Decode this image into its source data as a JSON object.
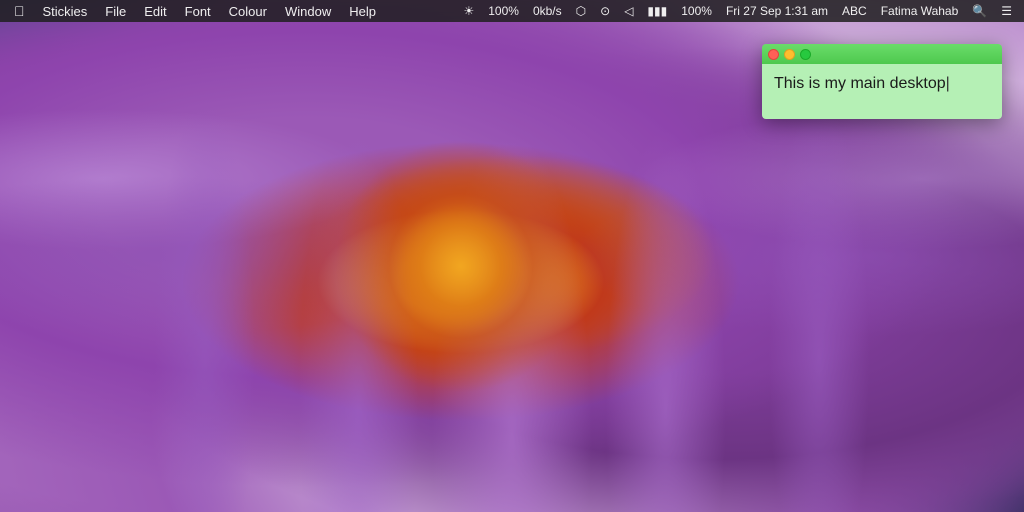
{
  "menubar": {
    "apple_label": "",
    "app_name": "Stickies",
    "menus": [
      "File",
      "Edit",
      "Font",
      "Colour",
      "Window",
      "Help"
    ],
    "right_items": {
      "brightness_icon": "☀",
      "brightness": "100%",
      "network_icon": "↑↓",
      "network_val": "0kb/s",
      "bluetooth_icon": "⬡",
      "airport_icon": "📶",
      "volume_icon": "🔊",
      "battery_icon": "🔋",
      "battery_pct": "100%",
      "datetime": "Fri 27 Sep  1:31 am",
      "abc_label": "ABC",
      "user": "Fatima Wahab",
      "search_icon": "🔍",
      "notification_icon": "☰"
    }
  },
  "sticky": {
    "text": "This is my main desktop",
    "bg_color": "#b5f0b5",
    "titlebar_color_top": "#6adc6a",
    "titlebar_color_bottom": "#4ec94e"
  }
}
